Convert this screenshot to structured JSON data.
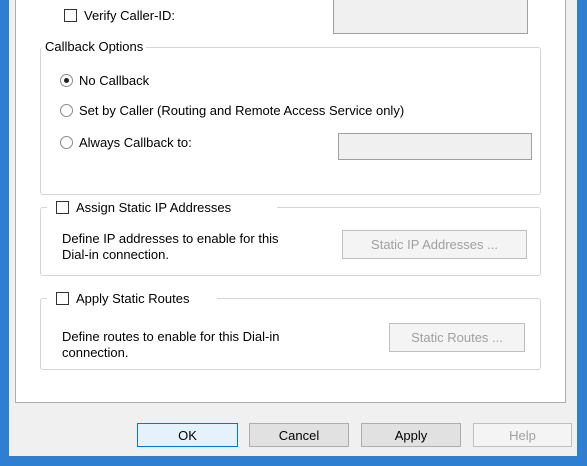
{
  "verify_caller_id": {
    "label": "Verify Caller-ID:",
    "checked": false,
    "value": ""
  },
  "callback_options": {
    "title": "Callback Options",
    "no_callback": "No Callback",
    "set_by_caller": "Set by Caller (Routing and Remote Access Service only)",
    "always_callback": "Always Callback to:",
    "selected": "no_callback",
    "callback_number": ""
  },
  "static_ip": {
    "label": "Assign Static IP Addresses",
    "checked": false,
    "description_line1": "Define IP addresses to enable for this",
    "description_line2": "Dial-in connection.",
    "button": "Static IP Addresses ..."
  },
  "static_routes": {
    "label": "Apply Static Routes",
    "checked": false,
    "description_line1": "Define routes to enable for this Dial-in",
    "description_line2": "connection.",
    "button": "Static Routes ..."
  },
  "buttons": {
    "ok": "OK",
    "cancel": "Cancel",
    "apply": "Apply",
    "help": "Help"
  },
  "colors": {
    "frame": "#2e7fd1",
    "panel": "#ffffff",
    "dialog": "#f0f0f0",
    "disabled_text": "#a0a0a0"
  }
}
